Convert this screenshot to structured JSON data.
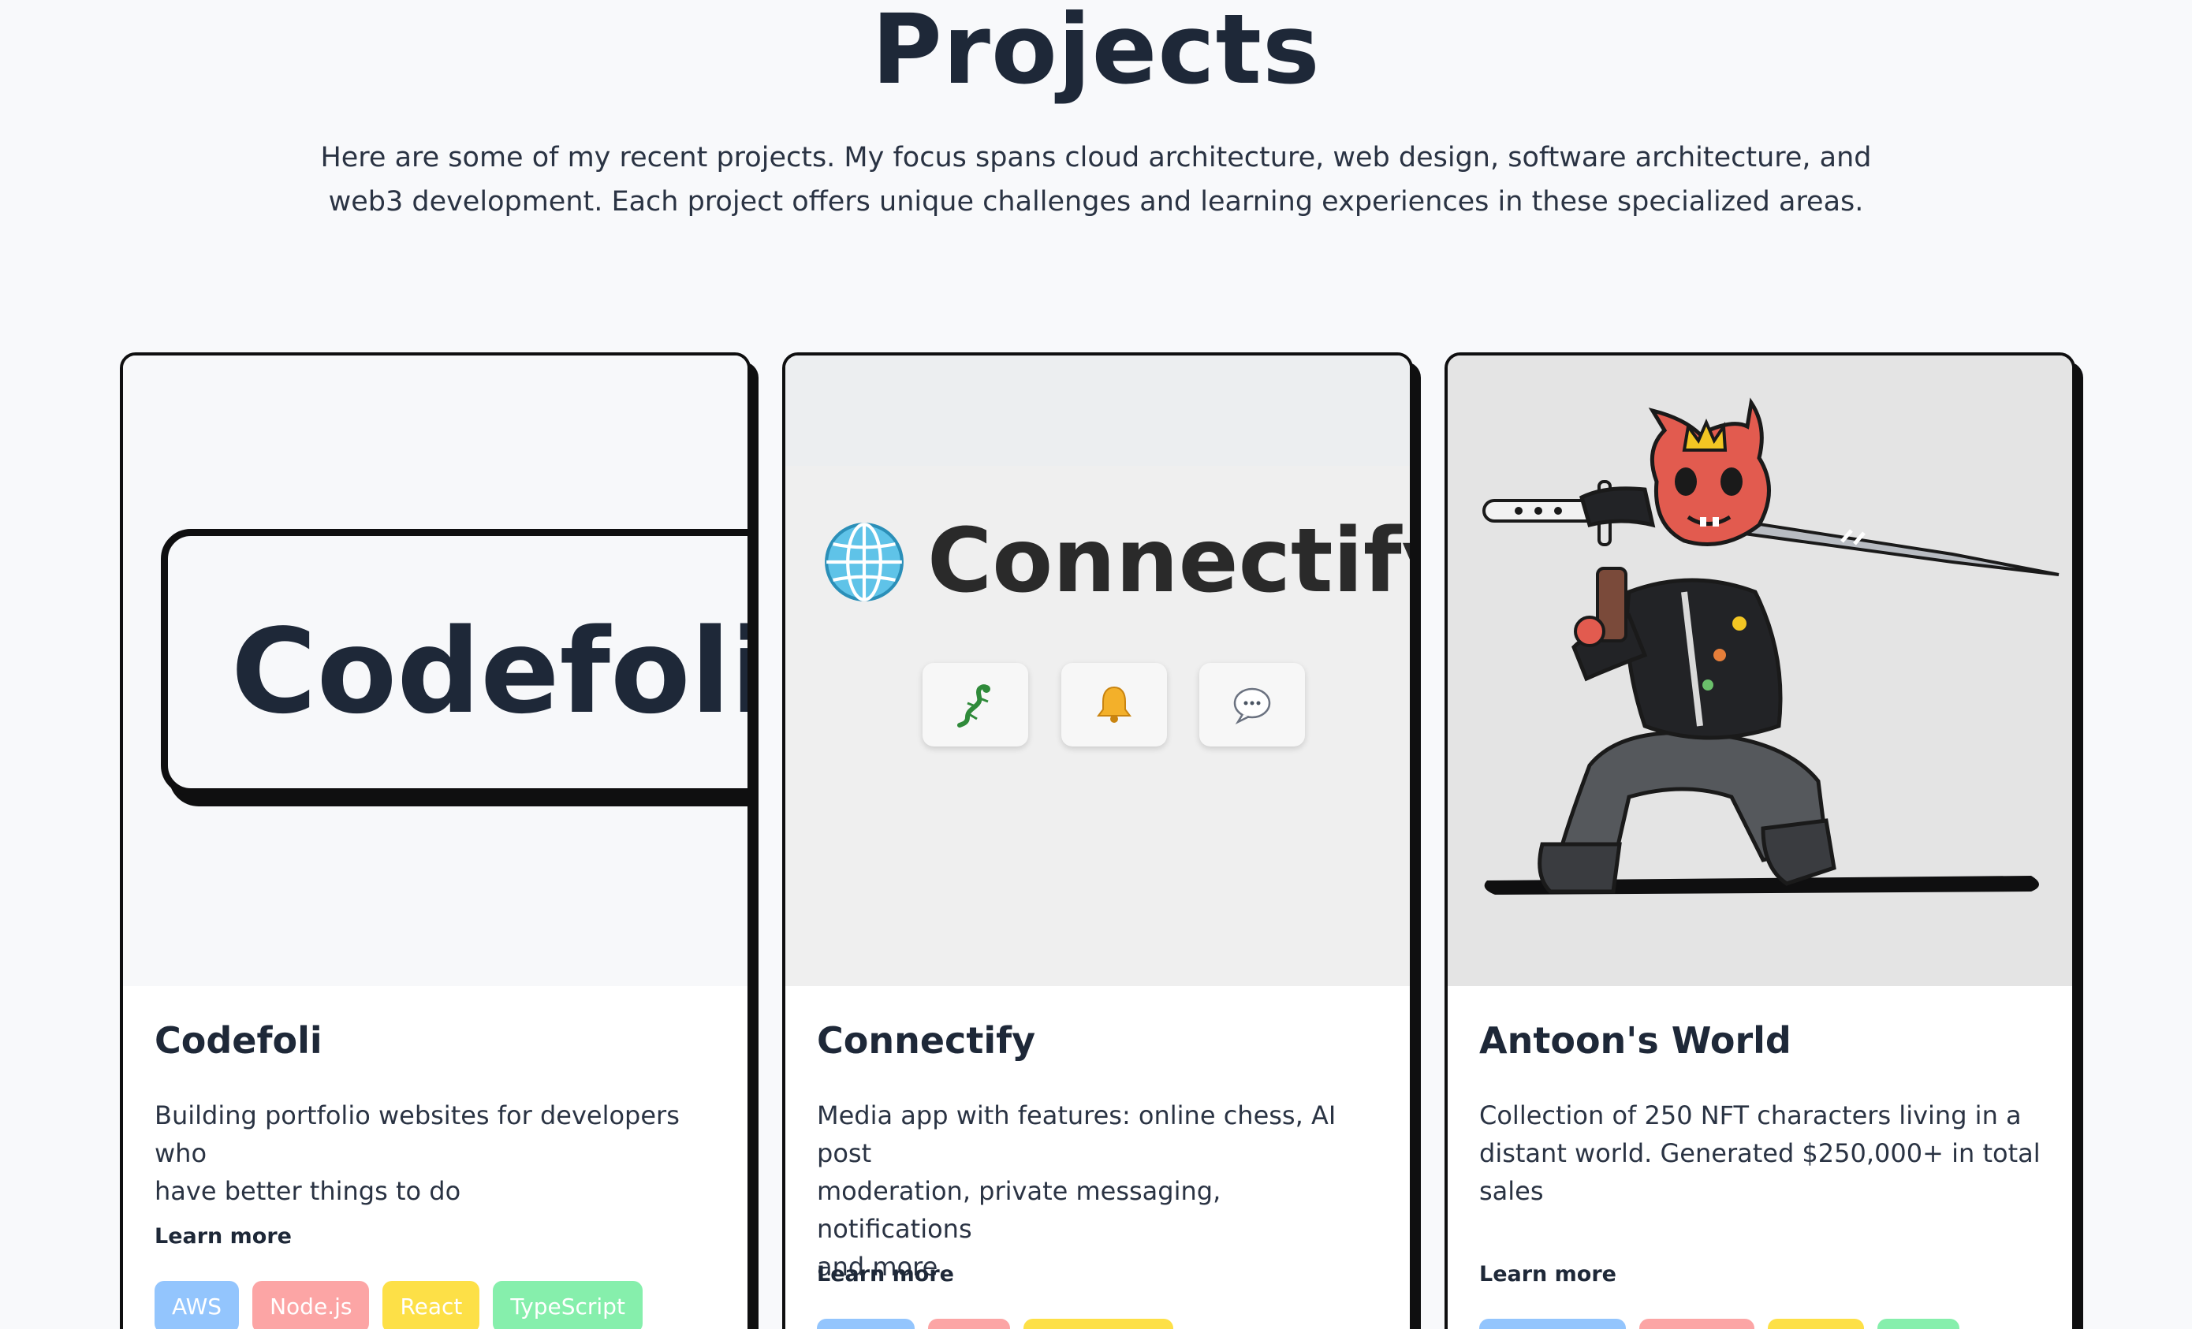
{
  "section": {
    "title": "Projects",
    "intro_line1": "Here are some of my recent projects. My focus spans cloud architecture, web design, software architecture, and",
    "intro_line2": "web3 development. Each project offers unique challenges and learning experiences in these specialized areas."
  },
  "colors": {
    "background": "#f8f9fb",
    "text": "#1e2838",
    "tag_blue": "#93c5fd",
    "tag_red": "#fca5a5",
    "tag_yellow": "#fde047",
    "tag_green": "#86efac"
  },
  "projects": [
    {
      "title": "Codefoli",
      "image_wordmark": "Codefoli",
      "desc_line1": "Building portfolio websites for developers who",
      "desc_line2": "have better things to do",
      "desc_line3": "",
      "link": "Learn more",
      "tags": [
        "AWS",
        "Node.js",
        "React",
        "TypeScript"
      ]
    },
    {
      "title": "Connectify",
      "image_wordmark": "Connectify",
      "image_icons": [
        "globe-icon",
        "lizard-icon",
        "bell-icon",
        "chat-bubble-icon"
      ],
      "desc_line1": "Media app with features: online chess, AI post",
      "desc_line2": "moderation, private messaging, notifications",
      "desc_line3": "and more",
      "link": "Learn more",
      "tags": [
        "",
        "",
        ""
      ]
    },
    {
      "title": "Antoon's World",
      "desc_line1": "Collection of 250 NFT characters living in a",
      "desc_line2": "distant world. Generated $250,000+ in total",
      "desc_line3": "sales",
      "link": "Learn more",
      "tags": [
        "",
        "",
        "",
        ""
      ]
    }
  ]
}
